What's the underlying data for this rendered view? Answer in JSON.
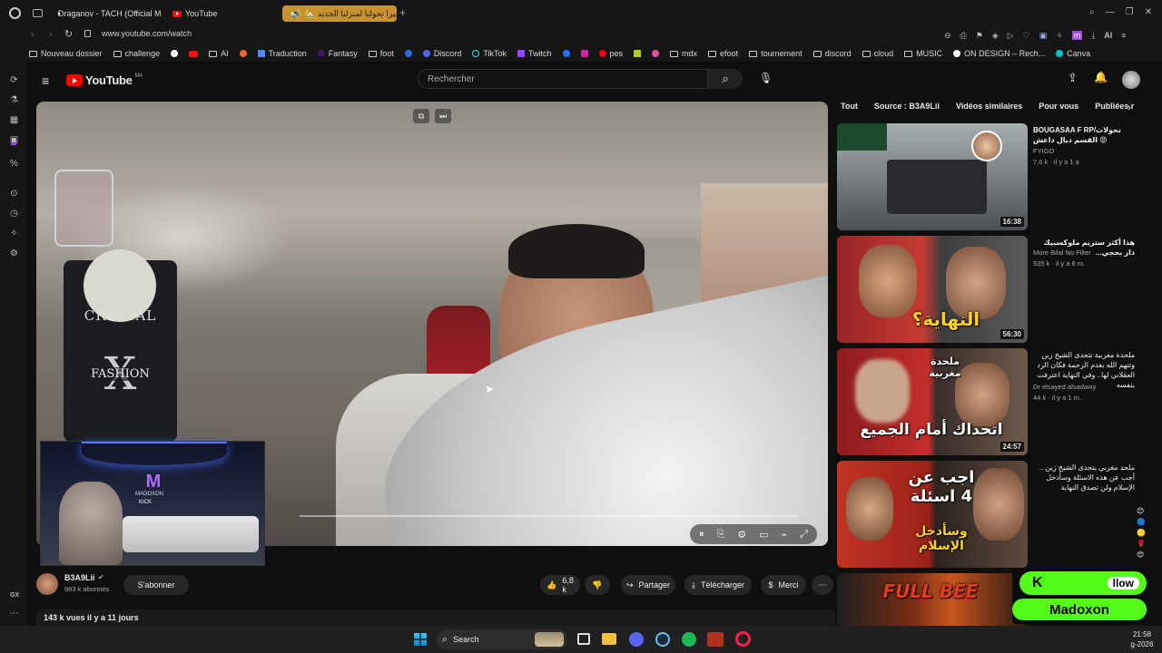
{
  "browser": {
    "tabs": [
      {
        "label": "Draganov - TACH (Official M"
      },
      {
        "label": "YouTube"
      },
      {
        "label": "أخيرا تحولنا لمنزلنا الجديد 🏡"
      }
    ],
    "url": "www.youtube.com/watch",
    "ai_label": "AI",
    "bookmarks": [
      "Nouveau dossier",
      "challenge",
      "AI",
      "Traduction",
      "Fantasy",
      "foot",
      "Discord",
      "TikTok",
      "Twitch",
      "pes",
      "mdx",
      "efoot",
      "tournement",
      "discord",
      "cloud",
      "MUSIC",
      "ON DESIGN – Rech...",
      "Canva"
    ],
    "sidebar_label": "GX"
  },
  "youtube": {
    "logo": "YouTube",
    "region": "MA",
    "search_placeholder": "Rechercher",
    "chips": [
      "Tout",
      "Source : B3A9Lii",
      "Vidéos similaires",
      "Pour vous",
      "Publiées r"
    ],
    "channel": {
      "name": "B3A9Lii",
      "subs": "983 k abonnés",
      "subscribe": "S'abonner"
    },
    "actions": {
      "likes": "6,8 k",
      "share": "Partager",
      "download": "Télécharger",
      "thanks": "Merci"
    },
    "description": "143 k vues  il y a 11 jours",
    "video": {
      "tag_top": "CRYSTAL",
      "tag_letter": "X",
      "tag_bottom": "FASHION",
      "cam_logo": "M",
      "cam_text": "MADOXON",
      "cam_kick": "KICK"
    },
    "recommendations": [
      {
        "title": "BOUGASAA F RP/تحولات القسم ديال داعش 😡",
        "channel": "FYIGO",
        "meta": "7,6 k · il y a 1 a",
        "duration": "16:38",
        "thumb_caption": ""
      },
      {
        "title": "هذا أكثر ستريم ملوكسبيك داز بحجي...",
        "channel": "More Bilal No Filter",
        "meta": "535 k · il y a 6 m.",
        "duration": "56:30",
        "thumb_caption": "النهاية؟"
      },
      {
        "title": "ملحدة مغربية تتحدى الشيخ زين وتتهم الله بعدم الرحمة فكان الرد العقلاني لها.. وفي النهاية اعترفت بنفسه",
        "channel": "Dr elsayed alsadawy",
        "meta": "44 k · il y a 1 m.",
        "duration": "24:57",
        "thumb_caption": "اتحداك أمام الجميع",
        "thumb_caption2": "ملحدة مغربية"
      },
      {
        "title": "ملحد مغربي يتحدى الشيخ زين .. أجب عن هذه الاسئلة وسأدخل الإسلام ولن تصدق النهاية",
        "channel": "",
        "meta": "",
        "duration": "",
        "thumb_caption": "اجب عن 4 اسئلة",
        "thumb_caption2": "وسأدخل الإسلام"
      },
      {
        "title": "",
        "channel": "",
        "meta": "",
        "duration": "",
        "thumb_caption": "FULL BEE"
      }
    ]
  },
  "overlay": {
    "kick_letter": "K",
    "follow": "llow",
    "name": "Madoxon"
  },
  "taskbar": {
    "search": "Search",
    "time": "21:58",
    "date": "g-2026"
  }
}
